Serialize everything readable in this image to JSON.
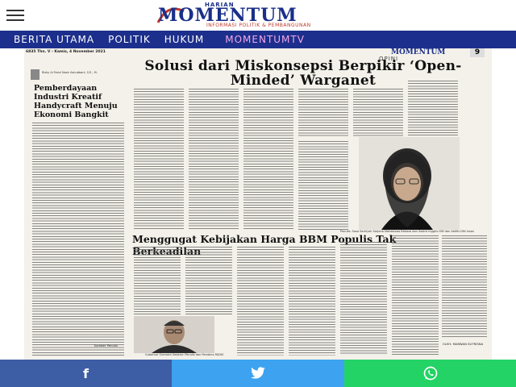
{
  "header": {
    "logo_harian": "HARIAN",
    "logo_main": "MOMENTUM",
    "logo_tagline": "INFORMASI POLITIK & PEMBANGUNAN"
  },
  "nav": {
    "items": [
      {
        "label": "BERITA UTAMA"
      },
      {
        "label": "POLITIK"
      },
      {
        "label": "HUKUM"
      },
      {
        "label": "MOMENTUMTV"
      }
    ]
  },
  "paper": {
    "issue_line": "6835 Thn. V - Kamis, 4 November 2021",
    "mini_logo": "MOMENTUM",
    "page_number": "9",
    "section": "OPINI",
    "left_article": {
      "title": "Pemberdayaan Industri Kreatif Handycraft Menuju Ekonomi Bangkit",
      "author_caption": "Rizky Al Farizi Nasir Ashubbani, S.E., M."
    },
    "main_article": {
      "title": "Solusi dari Miskonsepsi Berpikir ‘Open-Minded’ Warganet",
      "photo_caption": "Penulis: Sasa Sadriyah Sarjana Mahasiswa Bahasa dan Sastra Inggris ISM dan Aktifis DIN Insan"
    },
    "second_article": {
      "title": "Menggugat Kebijakan Harga BBM Populis Tak Berkeadilan",
      "photo_caption": "Gubernur Sumatra Selatan: Penulis dan Pembina RSDM"
    },
    "left_footer": "Sumber Penulis",
    "right_footer": "OLEH: MARWAN SUTRISNA"
  },
  "share": {
    "facebook": "f",
    "twitter": "twitter-bird",
    "whatsapp": "whatsapp-icon",
    "colors": {
      "facebook": "#3d5da4",
      "twitter": "#3da3f0",
      "whatsapp": "#24d366"
    }
  }
}
